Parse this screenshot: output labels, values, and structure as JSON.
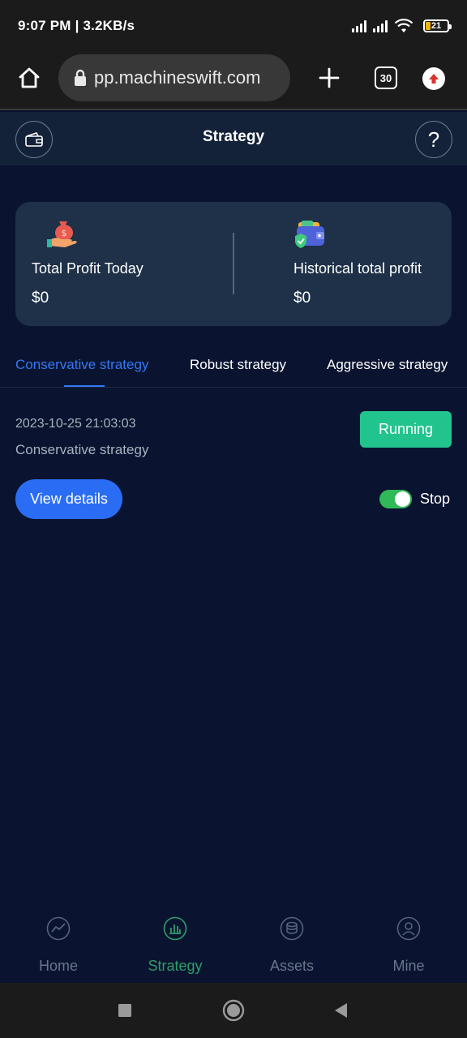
{
  "status_bar": {
    "time": "9:07 PM | 3.2KB/s",
    "battery": "21"
  },
  "browser": {
    "url": "pp.machineswift.com",
    "tab_count": "30"
  },
  "header": {
    "title": "Strategy"
  },
  "profit_card": {
    "today_label": "Total Profit Today",
    "today_value": "$0",
    "historical_label": "Historical total profit",
    "historical_value": "$0"
  },
  "tabs": [
    {
      "label": "Conservative strategy",
      "active": true
    },
    {
      "label": "Robust strategy",
      "active": false
    },
    {
      "label": "Aggressive strategy",
      "active": false
    }
  ],
  "strategy_item": {
    "datetime": "2023-10-25 21:03:03",
    "name": "Conservative strategy",
    "status": "Running",
    "details_label": "View details",
    "toggle_on": true,
    "toggle_label": "Stop"
  },
  "bottom_nav": [
    {
      "label": "Home",
      "icon": "trend-icon",
      "active": false
    },
    {
      "label": "Strategy",
      "icon": "bar-chart-icon",
      "active": true
    },
    {
      "label": "Assets",
      "icon": "coins-icon",
      "active": false
    },
    {
      "label": "Mine",
      "icon": "user-icon",
      "active": false
    }
  ],
  "colors": {
    "background": "#0a1430",
    "card": "#1e3148",
    "accent_blue": "#3478f6",
    "running_green": "#22c48e",
    "nav_active": "#2f9d6a"
  }
}
